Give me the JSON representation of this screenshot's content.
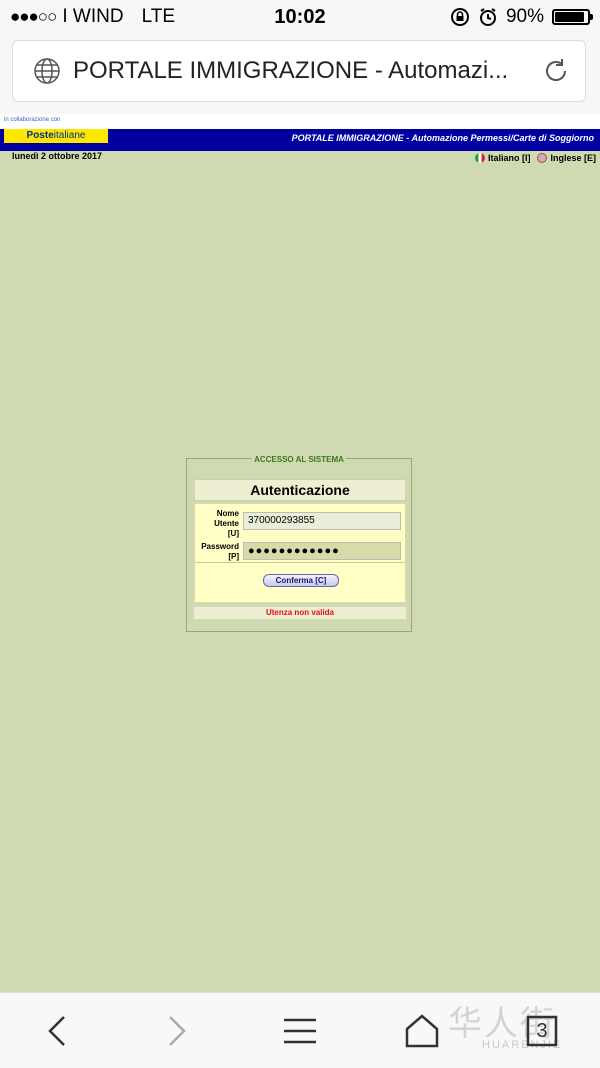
{
  "status_bar": {
    "signal": "●●●○○",
    "carrier": "I WIND",
    "network": "LTE",
    "time": "10:02",
    "battery": "90%",
    "battery_level": 0.9
  },
  "browser": {
    "page_title": "PORTALE IMMIGRAZIONE - Automazi...",
    "tab_count": "3"
  },
  "page": {
    "collab_text": "in collaborazione con",
    "poste_bold": "Poste",
    "poste_light": "italiane",
    "portal_title": "PORTALE IMMIGRAZIONE - Automazione Permessi/Carte di Soggiorno",
    "date": "lunedì 2 ottobre 2017",
    "lang_it": "Italiano [I]",
    "lang_en": "Inglese [E]"
  },
  "login": {
    "legend": "ACCESSO AL SISTEMA",
    "heading": "Autenticazione",
    "username_label_1": "Nome",
    "username_label_2": "Utente",
    "username_label_3": "[U]",
    "username_value": "370000293855",
    "password_label_1": "Password",
    "password_label_2": "[P]",
    "password_value": "●●●●●●●●●●●●",
    "confirm_button": "Conferma [C]",
    "error_message": "Utenza non valida"
  },
  "watermark": {
    "chars": "华人街",
    "latin": "HUARENJIE"
  }
}
